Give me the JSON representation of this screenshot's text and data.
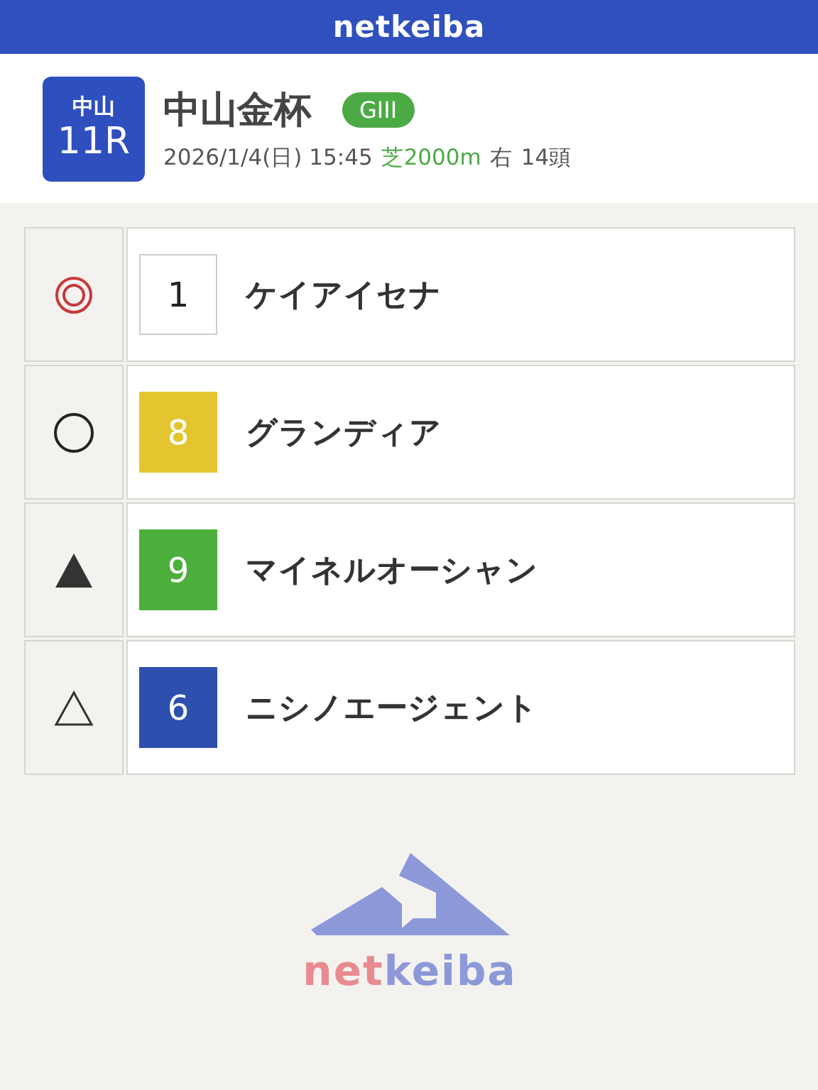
{
  "app_bar": {
    "logo": "netkeiba"
  },
  "race": {
    "venue": "中山",
    "number": "11R",
    "title": "中山金杯",
    "grade": "GIII",
    "date_time": "2026/1/4(日) 15:45",
    "course": "芝2000m",
    "direction": "右",
    "runners": "14頭"
  },
  "picks": [
    {
      "kind": "double-circle",
      "number": "1",
      "color": "#ffffff",
      "name": "ケイアイセナ"
    },
    {
      "kind": "circle",
      "number": "8",
      "color": "#e3c530",
      "name": "グランディア"
    },
    {
      "kind": "filled-triangle",
      "number": "9",
      "color": "#4caf3c",
      "name": "マイネルオーシャン"
    },
    {
      "kind": "triangle",
      "number": "6",
      "color": "#2d4fae",
      "name": "ニシノエージェント"
    }
  ],
  "footer_logo": {
    "parts": [
      {
        "text": "net",
        "color": "#e88a8f"
      },
      {
        "text": "keiba",
        "color": "#8c98d8"
      }
    ]
  }
}
